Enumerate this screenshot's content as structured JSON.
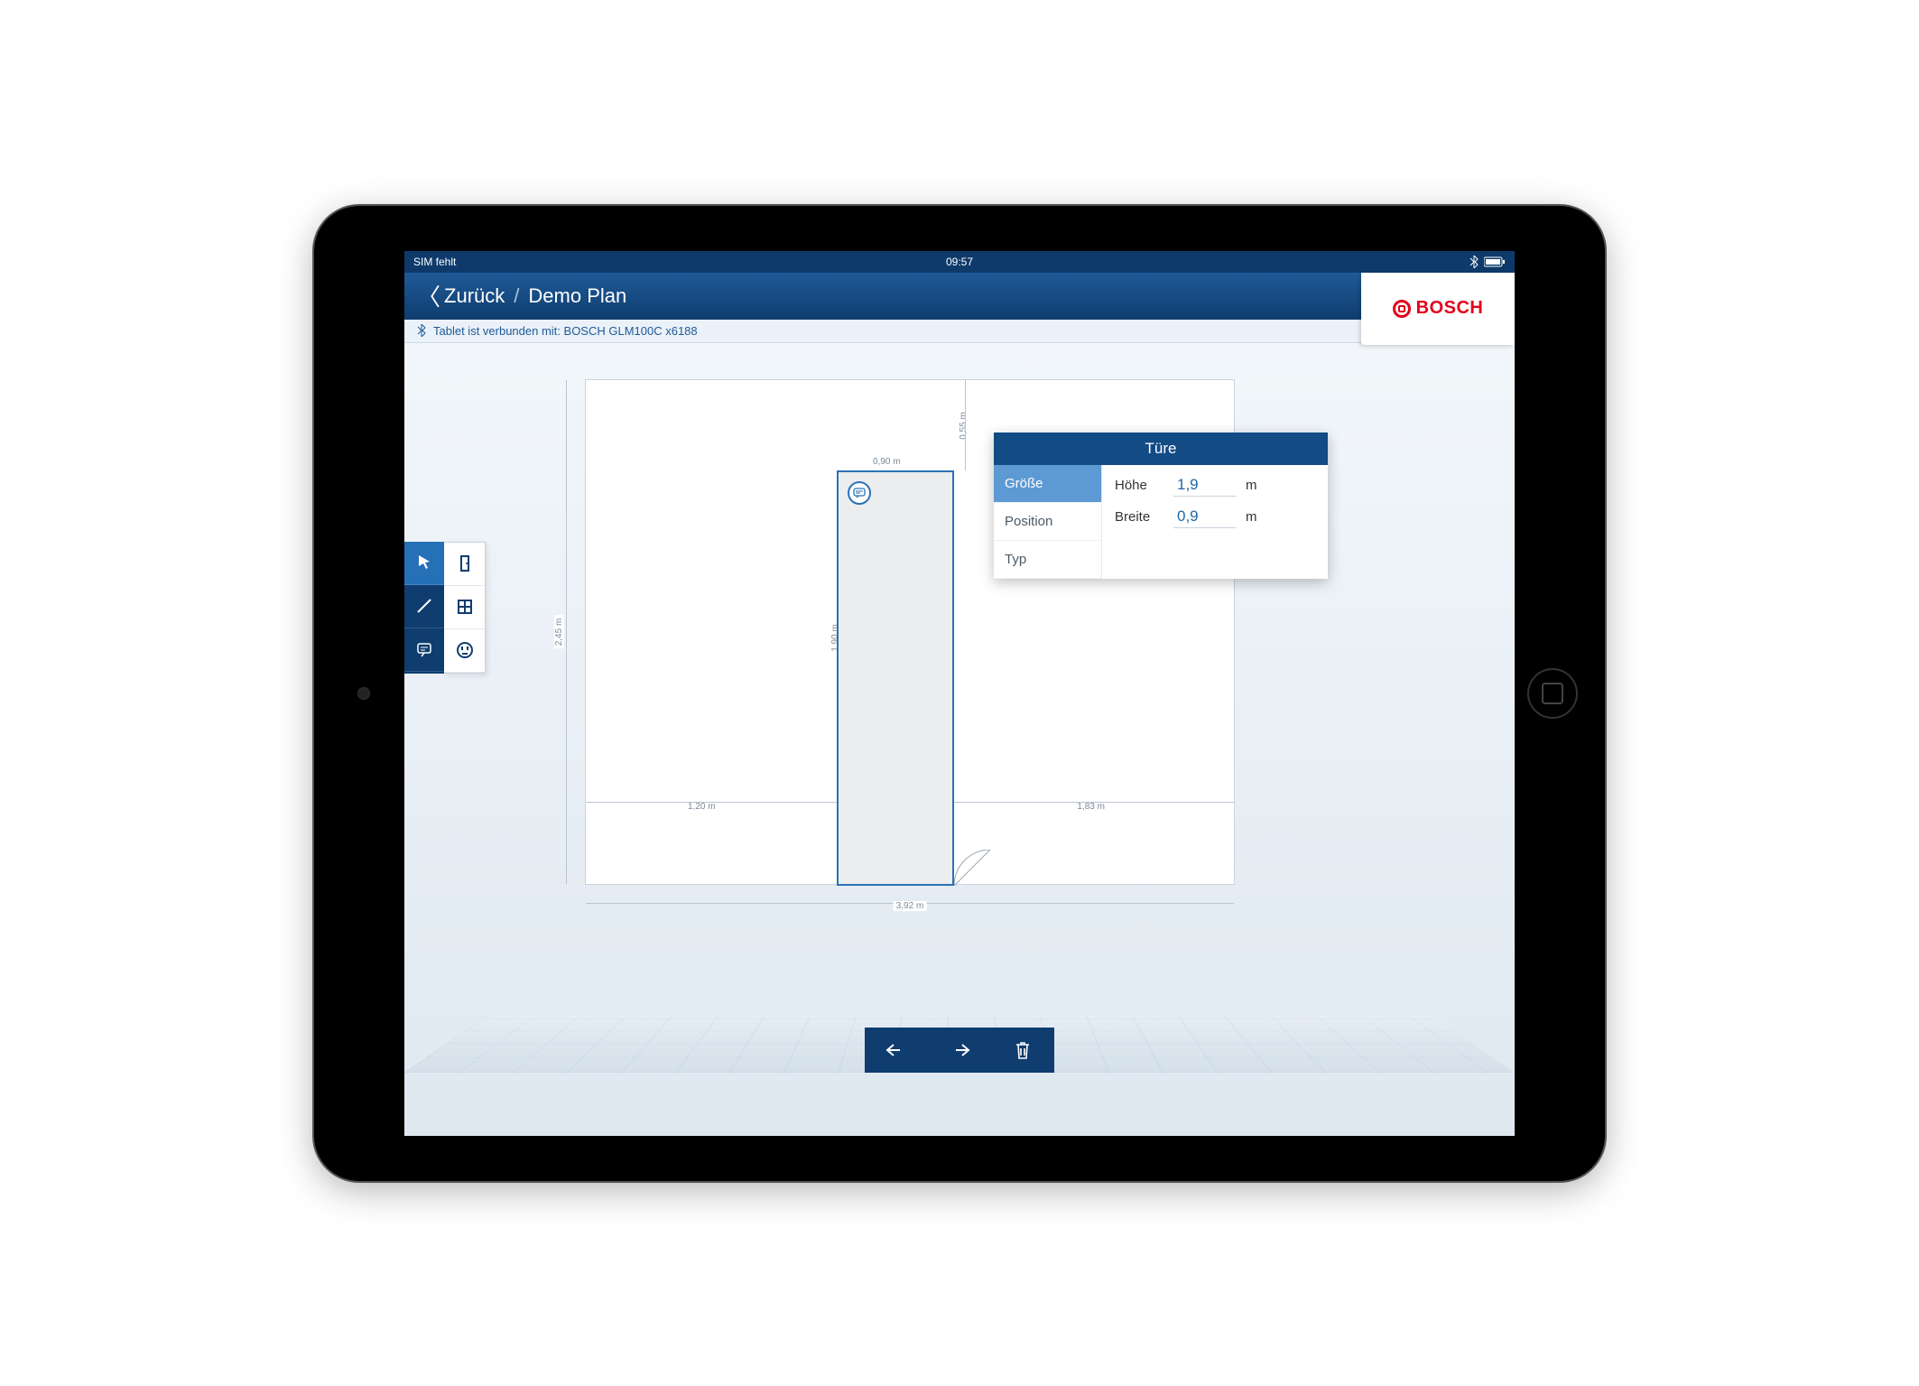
{
  "status": {
    "left": "SIM fehlt",
    "time": "09:57"
  },
  "header": {
    "back_label": "Zurück",
    "title": "Demo Plan",
    "logo": "BOSCH"
  },
  "connection": {
    "text": "Tablet ist verbunden mit: BOSCH GLM100C x6188"
  },
  "popup": {
    "title": "Türe",
    "tabs": {
      "size": "Größe",
      "position": "Position",
      "type": "Typ"
    },
    "fields": {
      "height_label": "Höhe",
      "height_value": "1,9",
      "height_unit": "m",
      "width_label": "Breite",
      "width_value": "0,9",
      "width_unit": "m"
    }
  },
  "dimensions": {
    "total_width": "3,92 m",
    "left_seg": "1,20 m",
    "door_width": "0,90 m",
    "right_seg": "1,83 m",
    "wall_height": "2,45 m",
    "door_height": "1,90 m",
    "top_gap": "0,55 m"
  }
}
